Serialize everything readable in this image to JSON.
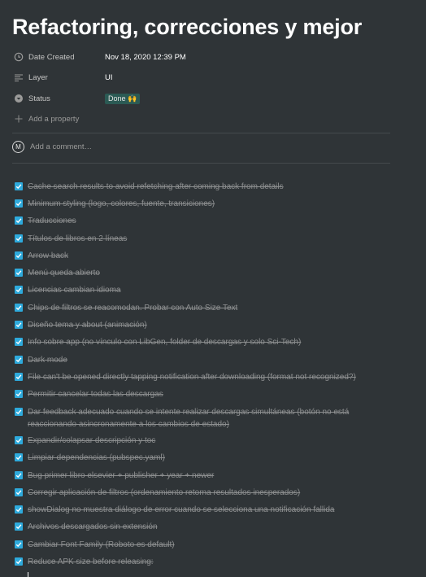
{
  "page": {
    "title": "Refactoring, correcciones y mejor"
  },
  "properties": [
    {
      "icon": "clock-icon",
      "name": "Date Created",
      "value": "Nov 18, 2020 12:39 PM"
    },
    {
      "icon": "text-lines-icon",
      "name": "Layer",
      "value": "UI"
    },
    {
      "icon": "select-icon",
      "name": "Status",
      "value": "Done 🙌"
    }
  ],
  "add_property_label": "Add a property",
  "comment": {
    "avatar_letter": "M",
    "placeholder": "Add a comment…"
  },
  "colors": {
    "checkbox": "#2eaadc",
    "status_badge": "#2b5a54",
    "background": "#2f3437"
  },
  "todos": [
    {
      "text": "Cache search results to avoid refetching after coming back from details",
      "checked": true
    },
    {
      "text": "Minimum styling (logo, colores, fuente, transiciones)",
      "checked": true
    },
    {
      "text": "Traducciones",
      "checked": true
    },
    {
      "text": "Títulos de libros en 2 líneas",
      "checked": true
    },
    {
      "text": "Arrow back",
      "checked": true
    },
    {
      "text": "Menú queda abierto",
      "checked": true
    },
    {
      "text": "Licencias cambian idioma",
      "checked": true
    },
    {
      "text": "Chips de filtros se reacomodan. Probar con Auto Size Text",
      "checked": true
    },
    {
      "text": "Diseño tema y about (animación)",
      "checked": true
    },
    {
      "text": "Info sobre app (no vínculo con LibGen, folder de descargas y solo Sci-Tech)",
      "checked": true
    },
    {
      "text": "Dark mode",
      "checked": true
    },
    {
      "text": "File can't be opened directly tapping notification after downloading (format not recognized?)",
      "checked": true
    },
    {
      "text": "Permitir cancelar todas las descargas",
      "checked": true
    },
    {
      "text": "Dar feedback adecuado cuando se intente realizar descargas simultáneas (botón no está reaccionando asincronamente a los cambios de estado)",
      "checked": true
    },
    {
      "text": "Expandir/colapsar descripción y toc",
      "checked": true
    },
    {
      "text": "Limpiar dependencias (pubspec.yaml)",
      "checked": true
    },
    {
      "text": "Bug primer libro elsevier + publisher + year + newer",
      "checked": true
    },
    {
      "text": "Corregir aplicación de filtros (ordenamiento retorna resultados inesperados)",
      "checked": true
    },
    {
      "text": "showDialog no muestra diálogo de error cuando se selecciona una notificación fallida",
      "checked": true
    },
    {
      "text": "Archivos descargados sin extensión",
      "checked": true
    },
    {
      "text": "Cambiar Font Family (Roboto es default)",
      "checked": true
    },
    {
      "text": "Reduce APK size before releasing:",
      "checked": true
    }
  ]
}
